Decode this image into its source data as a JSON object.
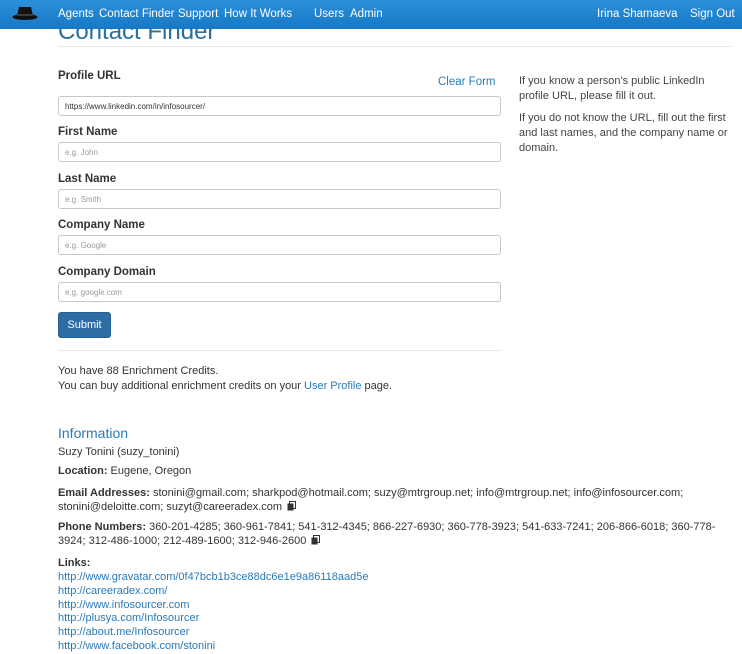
{
  "nav": {
    "logo_icon": "spy-hat-icon",
    "items": [
      "Agents",
      "Contact Finder",
      "Support",
      "How It Works",
      "Users",
      "Admin"
    ],
    "user": "Irina Shamaeva",
    "sign_out": "Sign Out"
  },
  "page_title": "Contact Finder",
  "form": {
    "profile_url_label": "Profile URL",
    "clear_form": "Clear Form",
    "profile_url_value": "https://www.linkedin.com/in/infosourcer/",
    "first_name_label": "First Name",
    "first_name_placeholder": "e.g. John",
    "last_name_label": "Last Name",
    "last_name_placeholder": "e.g. Smith",
    "company_name_label": "Company Name",
    "company_name_placeholder": "e.g. Google",
    "company_domain_label": "Company Domain",
    "company_domain_placeholder": "e.g. google.com",
    "submit": "Submit"
  },
  "help": {
    "p1": "If you know a person's public LinkedIn profile URL, please fill it out.",
    "p2": "If you do not know the URL, fill out the first and last names, and the company name or domain."
  },
  "credits": {
    "line1": "You have 88 Enrichment Credits.",
    "line2_prefix": "You can buy additional enrichment credits on your ",
    "line2_link": "User Profile",
    "line2_suffix": " page."
  },
  "information": {
    "title": "Information",
    "person_link": "Suzy Tonini (suzy_tonini)",
    "location_label": "Location:",
    "location_value": " Eugene, Oregon",
    "emails_label": "Email Addresses:",
    "emails_value": " stonini@gmail.com; sharkpod@hotmail.com; suzy@mtrgroup.net; info@mtrgroup.net; info@infosourcer.com; stonini@deloitte.com; suzyt@careeradex.com",
    "phones_label": "Phone Numbers:",
    "phones_value": " 360-201-4285; 360-961-7841; 541-312-4345; 866-227-6930; 360-778-3923; 541-633-7241; 206-866-6018; 360-778-3924; 312-486-1000; 212-489-1600; 312-946-2600",
    "links_label": "Links:",
    "links": [
      "http://www.gravatar.com/0f47bcb1b3ce88dc6e1e9a86118aad5e",
      "http://careeradex.com/",
      "http://www.infosourcer.com",
      "http://plusya.com/Infosourcer",
      "http://about.me/Infosourcer",
      "http://www.facebook.com/stonini"
    ]
  },
  "colors": {
    "navbar": "#1d83cf",
    "link": "#2a7ab8",
    "button": "#2e6da4"
  }
}
